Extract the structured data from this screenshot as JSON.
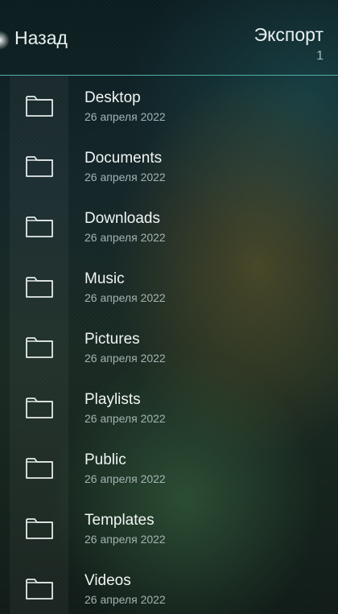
{
  "header": {
    "back_label": "Назад",
    "accept_label": "Экспорт",
    "selected_count": "1"
  },
  "folders": [
    {
      "name": "Desktop",
      "date": "26 апреля 2022",
      "icon": "folder-icon"
    },
    {
      "name": "Documents",
      "date": "26 апреля 2022",
      "icon": "folder-icon"
    },
    {
      "name": "Downloads",
      "date": "26 апреля 2022",
      "icon": "folder-icon"
    },
    {
      "name": "Music",
      "date": "26 апреля 2022",
      "icon": "folder-icon"
    },
    {
      "name": "Pictures",
      "date": "26 апреля 2022",
      "icon": "folder-icon"
    },
    {
      "name": "Playlists",
      "date": "26 апреля 2022",
      "icon": "folder-icon"
    },
    {
      "name": "Public",
      "date": "26 апреля 2022",
      "icon": "folder-icon"
    },
    {
      "name": "Templates",
      "date": "26 апреля 2022",
      "icon": "folder-icon"
    },
    {
      "name": "Videos",
      "date": "26 апреля 2022",
      "icon": "folder-icon"
    }
  ],
  "colors": {
    "accent": "#4fb0a8",
    "text_primary": "#f1f5f4",
    "text_secondary": "#a3b3b1"
  }
}
